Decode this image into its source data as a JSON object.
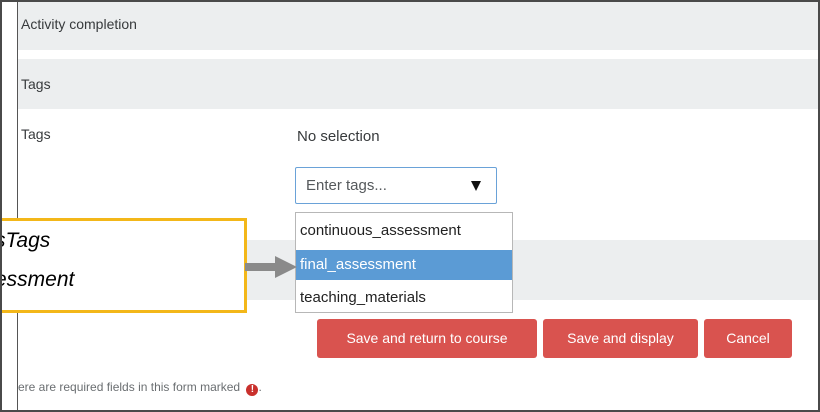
{
  "sections": {
    "activity_completion": "Activity completion",
    "tags": "Tags"
  },
  "tags_field": {
    "label": "Tags",
    "selection_text": "No selection",
    "input_placeholder": "Enter tags..."
  },
  "dropdown": {
    "items": [
      "continuous_assessment",
      "final_assessment",
      "teaching_materials"
    ],
    "selected": "final_assessment"
  },
  "buttons": {
    "save_return": "Save and return to course",
    "save_display": "Save and display",
    "cancel": "Cancel"
  },
  "footer": {
    "required_note": "ere are required fields in this form marked",
    "required_icon": "!",
    "required_suffix": "."
  },
  "callout": {
    "line1": "sTags",
    "line2": "essment",
    "border_color": "#f3b719"
  },
  "colors": {
    "button": "#d9534f",
    "selected_item": "#5b9bd5",
    "section_header": "#eceeef"
  }
}
